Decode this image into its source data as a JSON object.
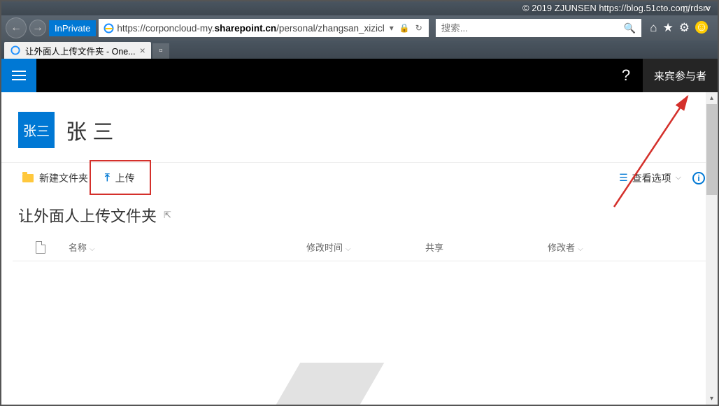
{
  "watermark": "© 2019 ZJUNSEN https://blog.51cto.com/rdsrv",
  "browser": {
    "inprivate_label": "InPrivate",
    "url_prefix": "https://corponcloud-my.",
    "url_bold": "sharepoint.cn",
    "url_suffix": "/personal/zhangsan_xizicl",
    "search_placeholder": "搜索...",
    "tab_title": "让外面人上传文件夹 - One..."
  },
  "header": {
    "help": "?",
    "user_role": "来宾参与者"
  },
  "profile": {
    "avatar_text": "张三",
    "username": "张 三"
  },
  "commands": {
    "new_folder": "新建文件夹",
    "upload": "上传",
    "view_options": "查看选项",
    "info": "i"
  },
  "page": {
    "folder_title": "让外面人上传文件夹"
  },
  "table": {
    "col_name": "名称",
    "col_time": "修改时间",
    "col_share": "共享",
    "col_author": "修改者"
  }
}
